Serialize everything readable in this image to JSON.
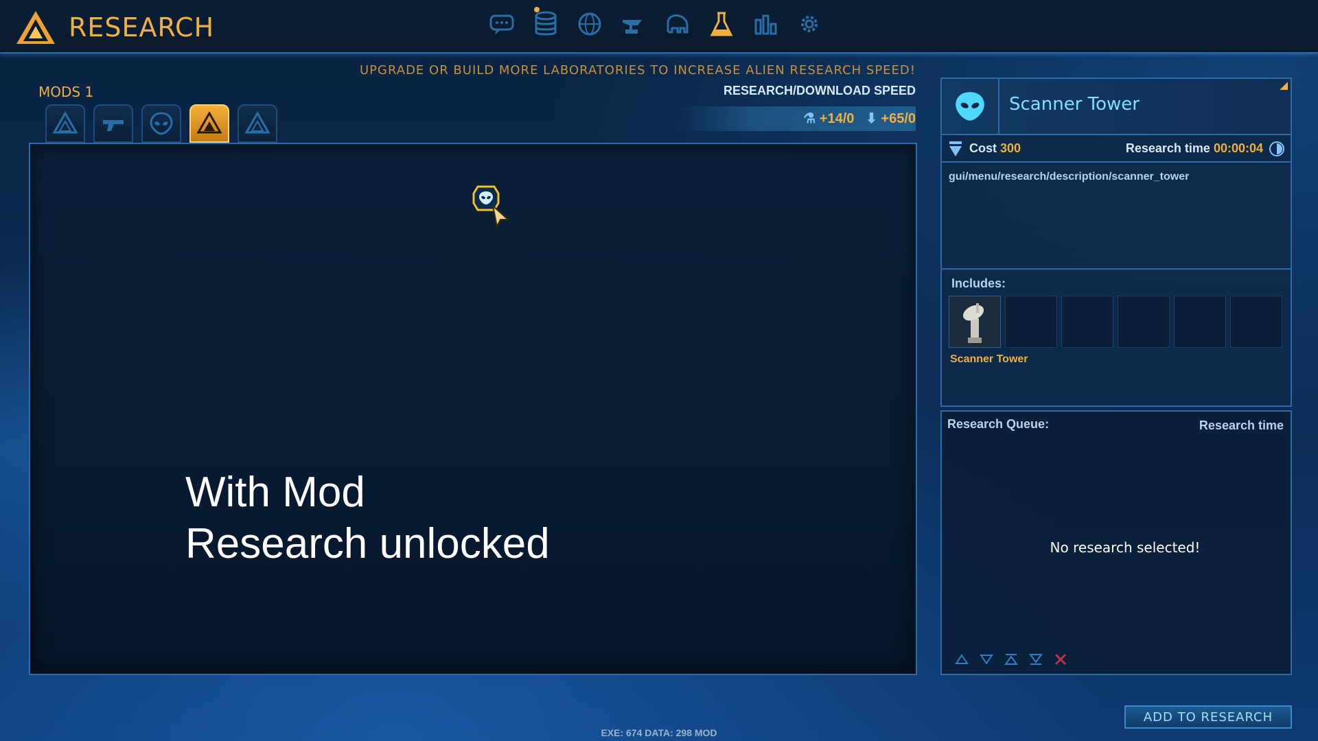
{
  "header": {
    "title": "RESEARCH",
    "nav": [
      {
        "name": "chat-icon"
      },
      {
        "name": "database-icon"
      },
      {
        "name": "globe-icon"
      },
      {
        "name": "anvil-icon"
      },
      {
        "name": "elephant-icon"
      },
      {
        "name": "flask-icon",
        "active": true
      },
      {
        "name": "stats-icon"
      },
      {
        "name": "gear-icon"
      }
    ]
  },
  "mods": {
    "label": "MODS 1",
    "tabs": [
      {
        "name": "mod-tab-logo-1",
        "active": false
      },
      {
        "name": "mod-tab-gun",
        "active": false
      },
      {
        "name": "mod-tab-alien",
        "active": false
      },
      {
        "name": "mod-tab-logo-active",
        "active": true
      },
      {
        "name": "mod-tab-logo-2",
        "active": false
      }
    ]
  },
  "research": {
    "hint": "UPGRADE OR BUILD MORE LABORATORIES TO INCREASE ALIEN RESEARCH SPEED!",
    "speed_label": "RESEARCH/DOWNLOAD SPEED",
    "research_speed": "+14/0",
    "download_speed": "+65/0"
  },
  "overlay": {
    "line1": "With Mod",
    "line2": "Research unlocked"
  },
  "detail": {
    "title": "Scanner Tower",
    "cost_label": "Cost",
    "cost_value": "300",
    "time_label": "Research time",
    "time_value": "00:00:04",
    "description": "gui/menu/research/description/scanner_tower",
    "includes_label": "Includes:",
    "includes_item": "Scanner Tower"
  },
  "queue": {
    "title": "Research Queue:",
    "time_header": "Research time",
    "empty_text": "No research selected!"
  },
  "actions": {
    "add_label": "ADD TO RESEARCH"
  },
  "footer": {
    "text": "EXE: 674  DATA: 298  MOD"
  },
  "colors": {
    "accent": "#f0b040",
    "title_cyan": "#7fe0ff",
    "border": "#2f6ba6"
  }
}
